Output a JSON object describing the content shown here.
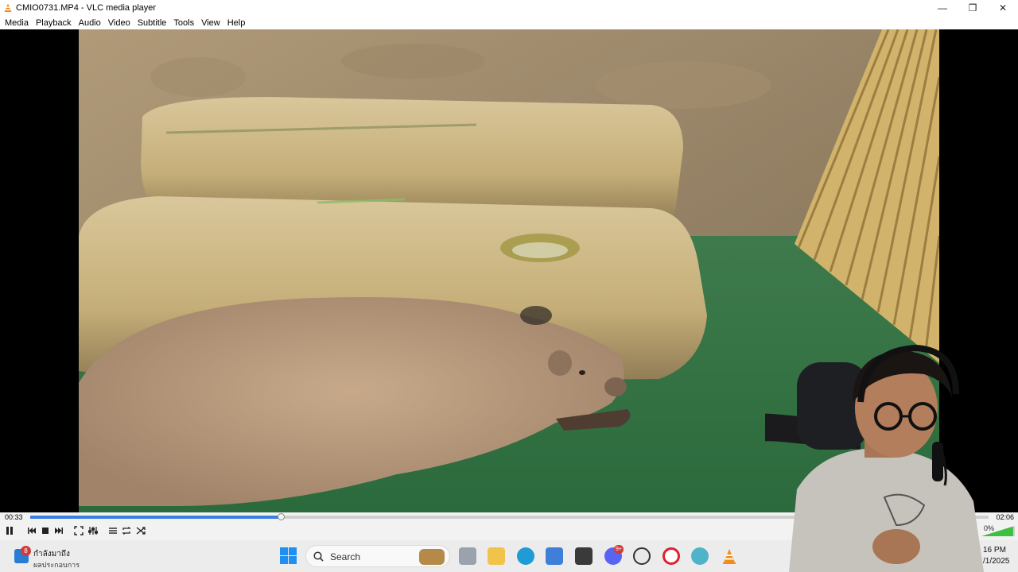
{
  "window": {
    "title": "CMIO0731.MP4 - VLC media player",
    "minimize_glyph": "—",
    "restore_glyph": "❐",
    "close_glyph": "✕"
  },
  "menu": {
    "items": [
      "Media",
      "Playback",
      "Audio",
      "Video",
      "Subtitle",
      "Tools",
      "View",
      "Help"
    ]
  },
  "playback": {
    "current_time": "00:33",
    "total_time": "02:06",
    "progress": 0.262,
    "volume_text": "0%",
    "volume_level": 0.95,
    "state": "playing"
  },
  "taskbar": {
    "weather_line1": "กำลังมาถึง",
    "weather_line2": "ผลประกอบการ",
    "notification_count": "8",
    "search_label": "Search",
    "discord_badge": "9+",
    "clock_time": "16 PM",
    "clock_date": "/1/2025"
  },
  "colors": {
    "accent": "#3b7ee0",
    "vlc_orange": "#f28c1b",
    "taskbar_bg": "#ececec"
  }
}
